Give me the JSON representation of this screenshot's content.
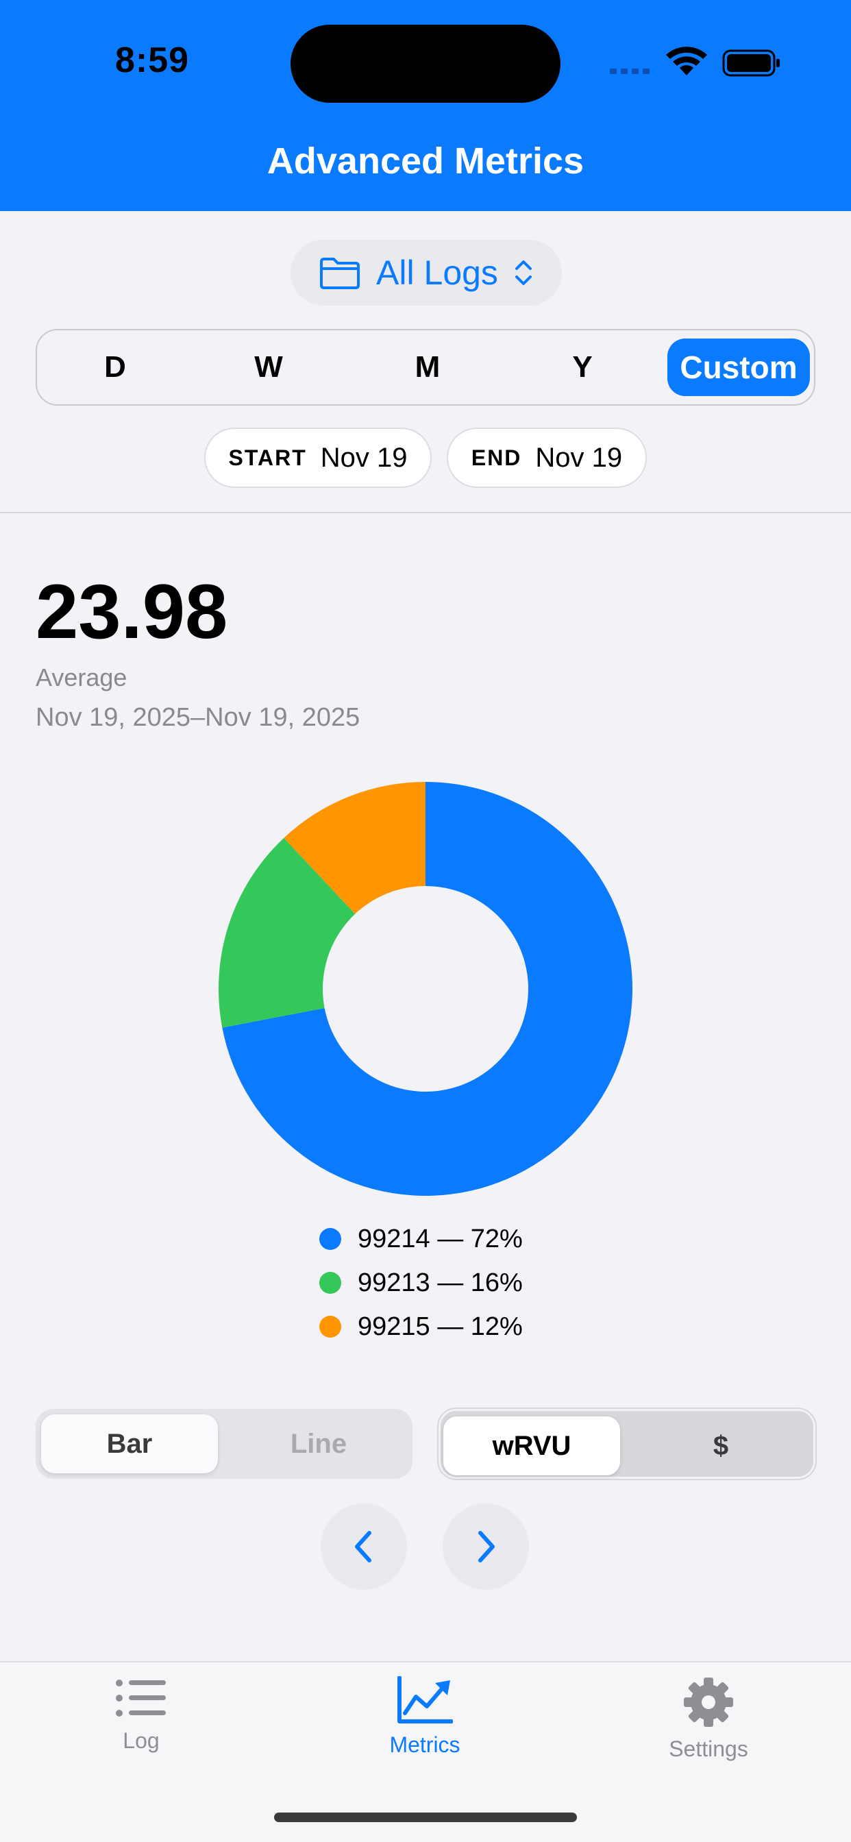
{
  "status": {
    "time": "8:59"
  },
  "header": {
    "title": "Advanced Metrics",
    "color": "#0a7aff"
  },
  "log_picker": {
    "label": "All Logs",
    "icon": "folder-icon"
  },
  "period": {
    "options": [
      "D",
      "W",
      "M",
      "Y",
      "Custom"
    ],
    "selected": "Custom"
  },
  "dates": {
    "start_label": "START",
    "start_value": "Nov 19",
    "end_label": "END",
    "end_value": "Nov 19"
  },
  "summary": {
    "value": "23.98",
    "label": "Average",
    "range": "Nov 19, 2025–Nov 19, 2025"
  },
  "chart_data": {
    "type": "pie",
    "style": "donut",
    "categories": [
      "99214",
      "99213",
      "99215"
    ],
    "values": [
      72,
      16,
      12
    ],
    "colors": [
      "#0a7aff",
      "#34c759",
      "#ff9500"
    ],
    "legend": [
      "99214 — 72%",
      "99213 — 16%",
      "99215 — 12%"
    ]
  },
  "chart_type_toggle": {
    "options": [
      "Bar",
      "Line"
    ],
    "selected": "Bar"
  },
  "metric_toggle": {
    "options": [
      "wRVU",
      "$"
    ],
    "selected": "wRVU"
  },
  "nav": {
    "prev_icon": "chevron-left-icon",
    "next_icon": "chevron-right-icon"
  },
  "tabbar": {
    "items": [
      {
        "label": "Log",
        "icon": "list-icon"
      },
      {
        "label": "Metrics",
        "icon": "chart-line-icon"
      },
      {
        "label": "Settings",
        "icon": "gear-icon"
      }
    ],
    "selected": "Metrics"
  }
}
